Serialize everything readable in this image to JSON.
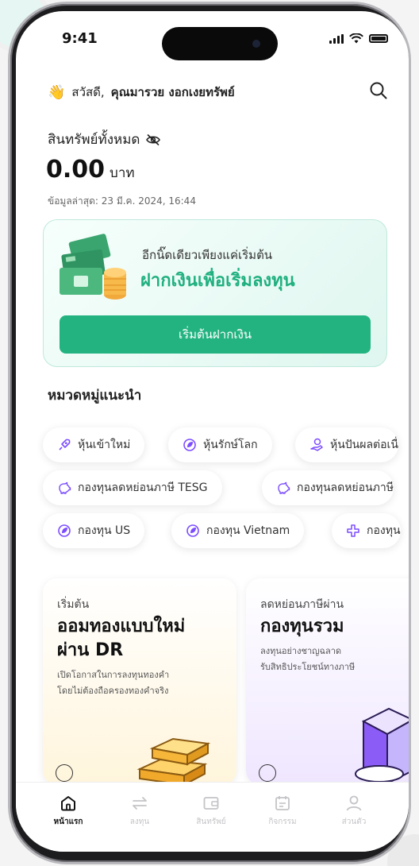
{
  "status": {
    "time": "9:41"
  },
  "header": {
    "greeting": "สวัสดี,",
    "user_name": "คุณมารวย งอกเงยทรัพย์",
    "hand_icon": "waving-hand-icon",
    "search_icon": "search-icon"
  },
  "assets": {
    "label": "สินทรัพย์ทั้งหมด",
    "hide_icon": "eye-off-icon",
    "amount": "0.00",
    "currency": "บาท",
    "updated": "ข้อมูลล่าสุด: 23 มี.ค. 2024, 16:44"
  },
  "promo": {
    "subtitle": "อีกนิ๊ดเดียวเพียงแค่เริ่มต้น",
    "title": "ฝากเงินเพื่อเริ่มลงทุน",
    "button": "เริ่มต้นฝากเงิน",
    "accent": "#23b381"
  },
  "categories": {
    "title": "หมวดหมู่แนะนำ",
    "chips": [
      {
        "label": "หุ้นเข้าใหม่",
        "icon": "rocket-icon"
      },
      {
        "label": "หุ้นรักษ์โลก",
        "icon": "leaf-icon"
      },
      {
        "label": "หุ้นปันผลต่อเนื่",
        "icon": "coins-icon"
      },
      {
        "label": "กองทุนลดหย่อนภาษี TESG",
        "icon": "piggy-bank-icon"
      },
      {
        "label": "กองทุนลดหย่อนภาษี",
        "icon": "piggy-bank-icon"
      },
      {
        "label": "กองทุน US",
        "icon": "leaf-icon"
      },
      {
        "label": "กองทุน Vietnam",
        "icon": "leaf-icon"
      },
      {
        "label": "กองทุน",
        "icon": "plus-cross-icon"
      }
    ]
  },
  "cards": [
    {
      "kicker": "เริ่มต้น",
      "title_line1": "ออมทองแบบใหม่",
      "title_line2": "ผ่าน DR",
      "desc_line1": "เปิดโอกาสในการลงทุนทองคำ",
      "desc_line2": "โดยไม่ต้องถือครองทองคำจริง"
    },
    {
      "kicker": "ลดหย่อนภาษีผ่าน",
      "title_line1": "กองทุนรวม",
      "desc_line1": "ลงทุนอย่างชาญฉลาด",
      "desc_line2": "รับสิทธิประโยชน์ทางภาษี"
    }
  ],
  "tabs": [
    {
      "label": "หน้าแรก",
      "icon": "home-icon",
      "active": true
    },
    {
      "label": "ลงทุน",
      "icon": "swap-icon",
      "active": false
    },
    {
      "label": "สินทรัพย์",
      "icon": "wallet-icon",
      "active": false
    },
    {
      "label": "กิจกรรม",
      "icon": "calendar-icon",
      "active": false
    },
    {
      "label": "ส่วนตัว",
      "icon": "user-icon",
      "active": false
    }
  ]
}
